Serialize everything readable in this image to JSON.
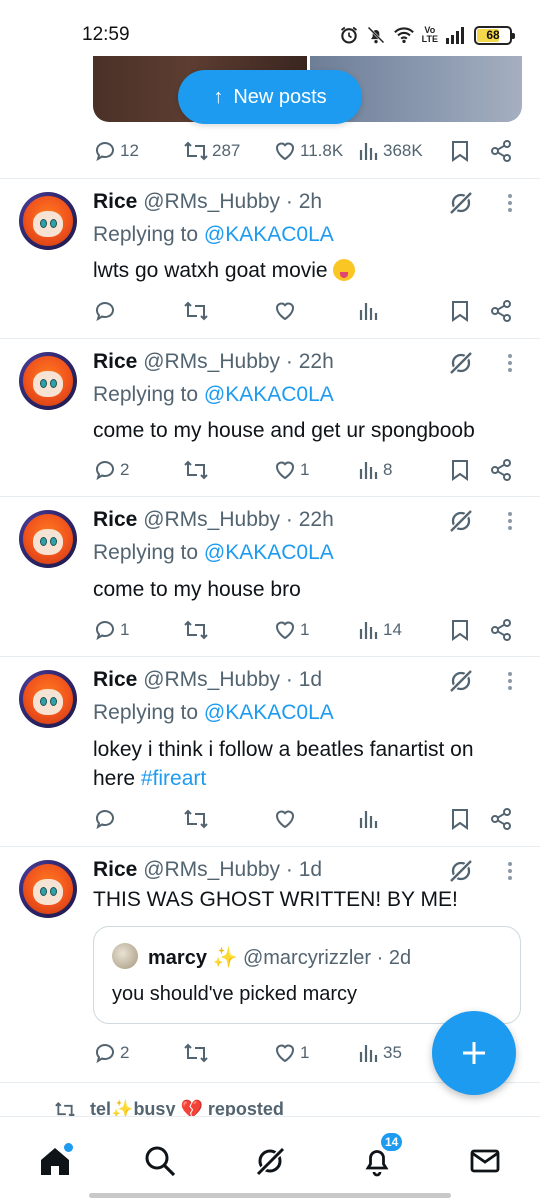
{
  "status_bar": {
    "time": "12:59",
    "network_label_top": "Vo",
    "network_label_bottom": "LTE",
    "battery": "68"
  },
  "top_post": {
    "new_posts_label": "New posts",
    "replies": "12",
    "reposts": "287",
    "likes": "11.8K",
    "views": "368K"
  },
  "tweets": [
    {
      "name": "Rice",
      "handle": "@RMs_Hubby",
      "time": "· 2h",
      "replying_prefix": "Replying to",
      "replying_handle": "@KAKAC0LA",
      "text": "lwts go watxh goat movie",
      "replies": "",
      "reposts": "",
      "likes": "",
      "views": ""
    },
    {
      "name": "Rice",
      "handle": "@RMs_Hubby",
      "time": "· 22h",
      "replying_prefix": "Replying to",
      "replying_handle": "@KAKAC0LA",
      "text": "come to my house and get ur spongboob",
      "replies": "2",
      "reposts": "",
      "likes": "1",
      "views": "8"
    },
    {
      "name": "Rice",
      "handle": "@RMs_Hubby",
      "time": "· 22h",
      "replying_prefix": "Replying to",
      "replying_handle": "@KAKAC0LA",
      "text": "come to my house bro",
      "replies": "1",
      "reposts": "",
      "likes": "1",
      "views": "14"
    },
    {
      "name": "Rice",
      "handle": "@RMs_Hubby",
      "time": "· 1d",
      "replying_prefix": "Replying to",
      "replying_handle": "@KAKAC0LA",
      "text": "lokey i think i follow a beatles fanartist on here",
      "hashtag": "#fireart",
      "replies": "",
      "reposts": "",
      "likes": "",
      "views": ""
    },
    {
      "name": "Rice",
      "handle": "@RMs_Hubby",
      "time": "· 1d",
      "text": "THIS WAS GHOST WRITTEN! BY ME!",
      "quote": {
        "name": "marcy",
        "sparkle": "✨",
        "handle": "@marcyrizzler",
        "time": "· 2d",
        "text": "you should've picked marcy"
      },
      "replies": "2",
      "reposts": "",
      "likes": "1",
      "views": "35"
    }
  ],
  "repost_banner": {
    "user": "tel",
    "sparkle": "✨",
    "user2": "busy",
    "heart": "💔",
    "label": "reposted"
  },
  "bottom_nav": {
    "notifications_badge": "14"
  },
  "colors": {
    "accent": "#1d9bf0",
    "text": "#0f1419",
    "muted": "#536471",
    "border": "#e6ecf0"
  }
}
